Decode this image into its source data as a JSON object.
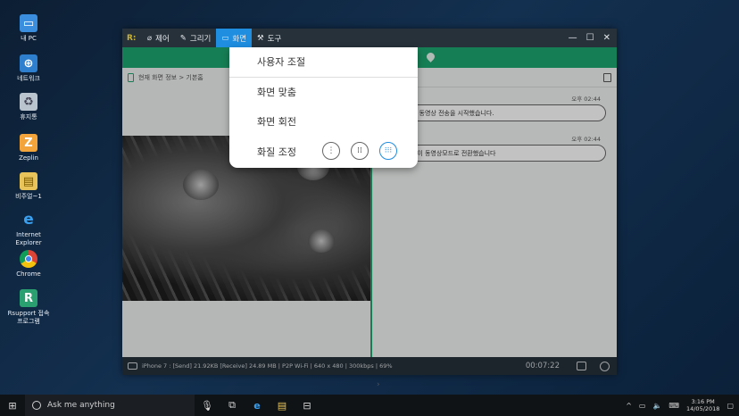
{
  "desktop": {
    "icons": [
      {
        "label": "내 PC",
        "icon": "computer-icon"
      },
      {
        "label": "네트워크",
        "icon": "network-icon"
      },
      {
        "label": "휴지통",
        "icon": "recycle-bin-icon"
      },
      {
        "label": "Zeplin",
        "icon": "zeplin-icon"
      },
      {
        "label": "비주얼~1",
        "icon": "folder-icon"
      },
      {
        "label": "Internet Explorer",
        "icon": "ie-icon"
      },
      {
        "label": "Chrome",
        "icon": "chrome-icon"
      },
      {
        "label": "Rsupport 접속프로그램",
        "icon": "rsupport-icon"
      }
    ]
  },
  "window": {
    "menu": {
      "control": "제어",
      "draw": "그리기",
      "screen": "화면",
      "tools": "도구"
    },
    "breadcrumb": "현재 화면 정보 > 기본홈",
    "chat": {
      "messages": [
        {
          "time": "오후 02:44",
          "text": "고객이 동영상 전송을 시작했습니다."
        },
        {
          "time": "오후 02:44",
          "text": "상담원이 동영상모드로 전환했습니다"
        }
      ]
    },
    "status": {
      "info": "iPhone 7 : [Send] 21.92KB  [Receive] 24.89 MB | P2P Wi-Fi | 640 x 480 | 300kbps | 69%",
      "timer": "00:07:22"
    }
  },
  "dropdown": {
    "items": {
      "user_adjust": "사용자 조절",
      "fit_screen": "화면 맞춤",
      "rotate_screen": "화면 회전",
      "quality": "화질 조정"
    },
    "quality_selected": "high"
  },
  "taskbar": {
    "search_placeholder": "Ask me anything",
    "clock_time": "3:16 PM",
    "clock_date": "14/05/2018"
  },
  "colors": {
    "accent_blue": "#1f8de0",
    "brand_green": "#1ea66f",
    "titlebar": "#26313a"
  }
}
